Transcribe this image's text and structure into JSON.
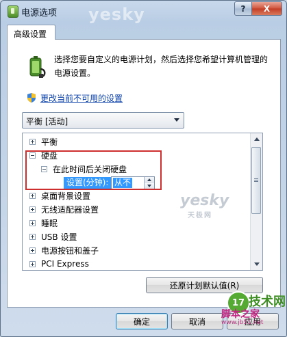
{
  "window": {
    "title": "电源选项",
    "help_label": "?",
    "close_label": "X"
  },
  "tab": {
    "label": "高级设置"
  },
  "description": "选择您要自定义的电源计划，然后选择您希望计算机管理的电源设置。",
  "change_link": "更改当前不可用的设置",
  "plan_select": {
    "value": "平衡 [活动]"
  },
  "tree": {
    "items": [
      {
        "label": "平衡",
        "state": "collapsed"
      },
      {
        "label": "硬盘",
        "state": "expanded"
      },
      {
        "label": "在此时间后关闭硬盘",
        "state": "expanded"
      },
      {
        "label": "桌面背景设置",
        "state": "collapsed"
      },
      {
        "label": "无线适配器设置",
        "state": "collapsed"
      },
      {
        "label": "睡眠",
        "state": "collapsed"
      },
      {
        "label": "USB 设置",
        "state": "collapsed"
      },
      {
        "label": "电源按钮和盖子",
        "state": "collapsed"
      },
      {
        "label": "PCI Express",
        "state": "collapsed"
      }
    ],
    "setting": {
      "label": "设置(分钟):",
      "value": "从不"
    }
  },
  "buttons": {
    "restore": "还原计划默认值(R)",
    "ok": "确定",
    "cancel": "取消",
    "apply": "应用"
  },
  "watermarks": {
    "top": "yesky",
    "mid": "yesky",
    "mid_sub": "天极网",
    "jsw_logo": "17",
    "jsw_text": "技术网",
    "jb": "脚本之家",
    "jb_url": "www.jb51.net"
  },
  "colors": {
    "highlight_box": "#cf2e2e",
    "selection": "#3399ff",
    "link": "#0a3fa8"
  }
}
